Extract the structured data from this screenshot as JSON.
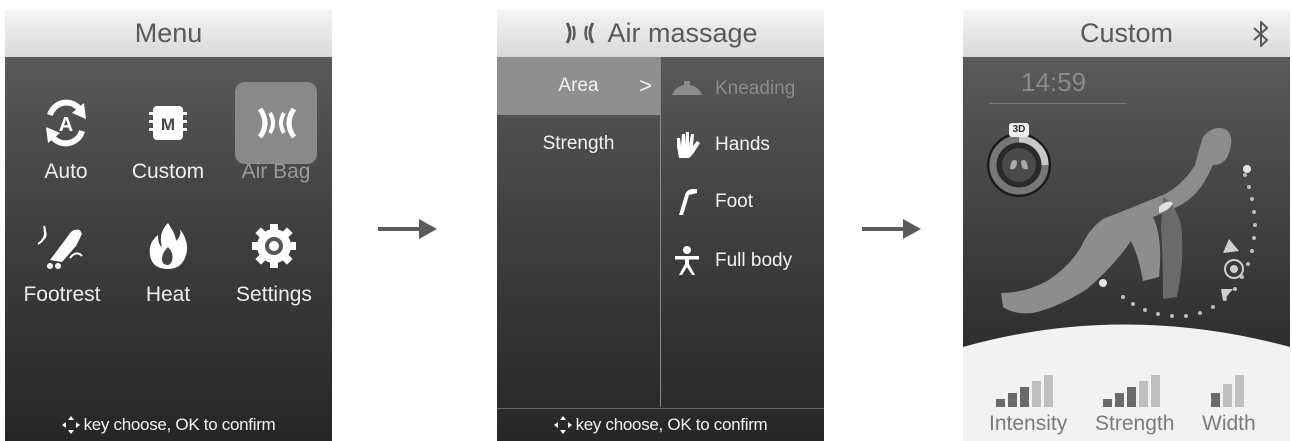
{
  "menu": {
    "title": "Menu",
    "items": [
      {
        "label": "Auto",
        "icon": "auto-icon"
      },
      {
        "label": "Custom",
        "icon": "custom-icon"
      },
      {
        "label": "Air Bag",
        "icon": "air-bag-icon",
        "selected": true
      },
      {
        "label": "Footrest",
        "icon": "footrest-icon"
      },
      {
        "label": "Heat",
        "icon": "heat-icon"
      },
      {
        "label": "Settings",
        "icon": "settings-icon"
      }
    ],
    "footer": "key choose, OK to confirm"
  },
  "air": {
    "title": "Air massage",
    "categories": [
      {
        "label": "Area",
        "selected": true
      },
      {
        "label": "Strength"
      }
    ],
    "options": [
      {
        "label": "Kneading",
        "icon": "kneading-icon",
        "dimmed": true
      },
      {
        "label": "Hands",
        "icon": "hand-icon"
      },
      {
        "label": "Foot",
        "icon": "foot-icon"
      },
      {
        "label": "Full body",
        "icon": "person-icon"
      }
    ],
    "footer": "key choose, OK to confirm"
  },
  "custom": {
    "title": "Custom",
    "time": "14:59",
    "badge": "3D",
    "levels": [
      {
        "label": "Intensity",
        "value": 3,
        "max": 5
      },
      {
        "label": "Strength",
        "value": 3,
        "max": 5
      },
      {
        "label": "Width",
        "value": 1,
        "max": 3
      }
    ]
  },
  "colors": {
    "accent": "#8f8f8f",
    "text": "#f2f2f2",
    "title_text": "#595959"
  }
}
